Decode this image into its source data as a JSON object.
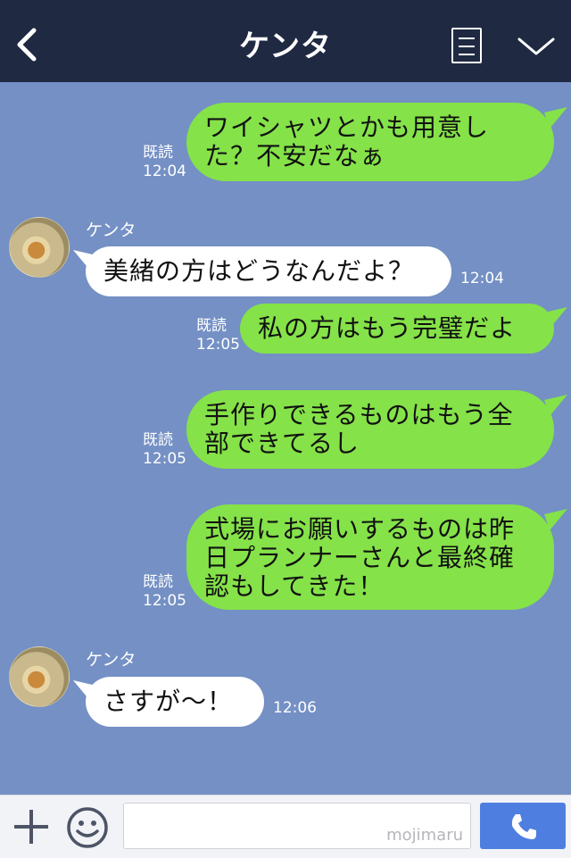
{
  "header": {
    "title": "ケンタ",
    "back_icon": "chevron-left-icon",
    "memo_icon": "note-icon",
    "menu_icon": "chevron-down-icon"
  },
  "messages": [
    {
      "from": "me",
      "text": "ワイシャツとかも用意した？不安だなぁ",
      "read": "既読",
      "time": "12:04"
    },
    {
      "from": "them",
      "sender": "ケンタ",
      "text": "美緒の方はどうなんだよ？",
      "time": "12:04"
    },
    {
      "from": "me",
      "text": "私の方はもう完璧だよ",
      "read": "既読",
      "time": "12:05"
    },
    {
      "from": "me",
      "text": "手作りできるものはもう全部できてるし",
      "read": "既読",
      "time": "12:05"
    },
    {
      "from": "me",
      "text": "式場にお願いするものは昨日プランナーさんと最終確認もしてきた！",
      "read": "既読",
      "time": "12:05"
    },
    {
      "from": "them",
      "sender": "ケンタ",
      "text": "さすが〜！",
      "time": "12:06"
    }
  ],
  "footer": {
    "plus_icon": "plus-icon",
    "emoji_icon": "smiley-icon",
    "watermark": "mojimaru",
    "call_icon": "phone-icon"
  },
  "colors": {
    "header_bg": "#1f2942",
    "chat_bg": "#7490c4",
    "my_bubble": "#85e249",
    "their_bubble": "#ffffff",
    "call_button": "#4e7fe0"
  }
}
